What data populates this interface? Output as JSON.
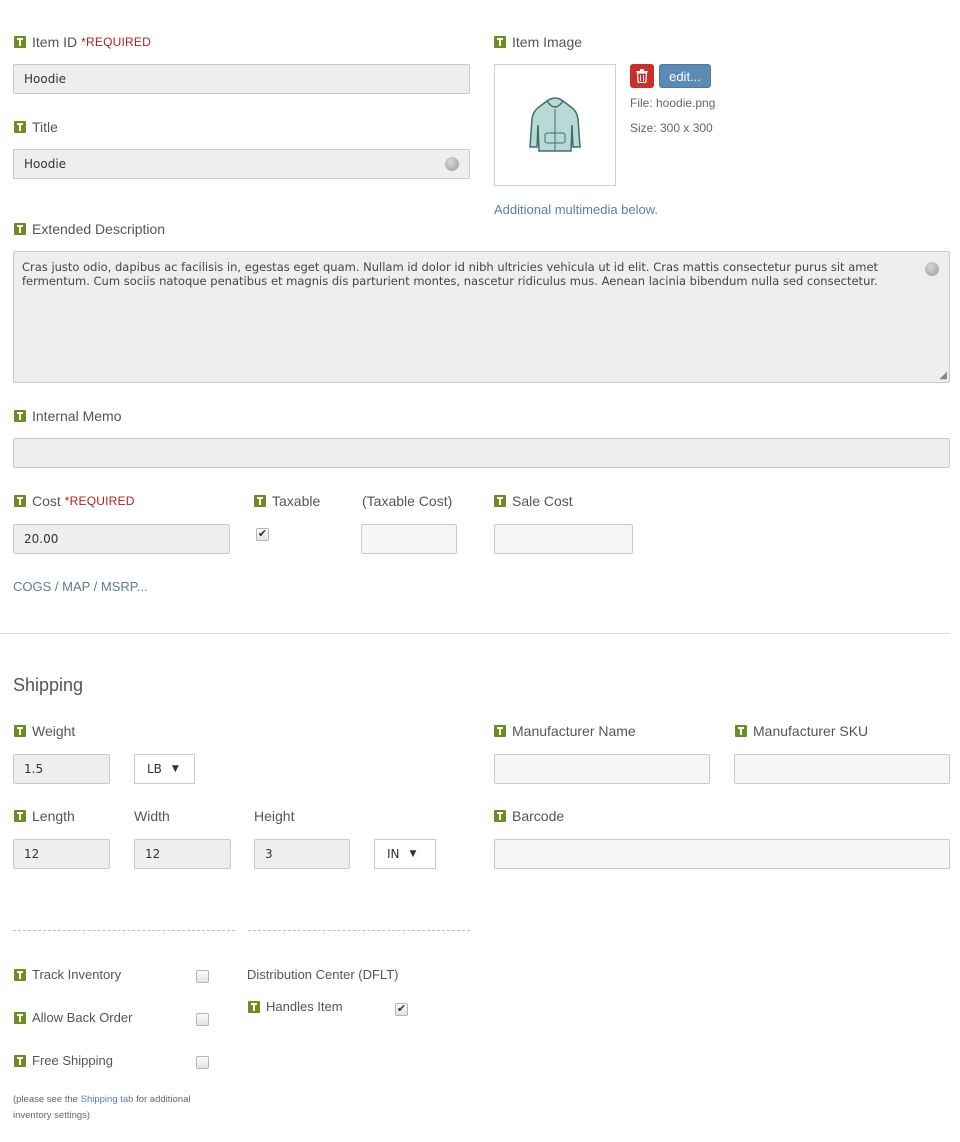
{
  "item_id": {
    "label": "Item ID",
    "required": "*REQUIRED",
    "value": "Hoodie"
  },
  "title": {
    "label": "Title",
    "value": "Hoodie"
  },
  "item_image": {
    "label": "Item Image",
    "edit_label": "edit...",
    "file": "File: hoodie.png",
    "size": "Size: 300 x 300",
    "additional": "Additional multimedia below."
  },
  "extended_description": {
    "label": "Extended Description",
    "value": "Cras justo odio, dapibus ac facilisis in, egestas eget quam. Nullam id dolor id nibh ultricies vehicula ut id elit. Cras mattis consectetur purus sit amet fermentum. Cum sociis natoque penatibus et magnis dis parturient montes, nascetur ridiculus mus. Aenean lacinia bibendum nulla sed consectetur."
  },
  "internal_memo": {
    "label": "Internal Memo",
    "value": ""
  },
  "cost": {
    "label": "Cost",
    "required": "*REQUIRED",
    "value": "20.00"
  },
  "taxable": {
    "label": "Taxable",
    "checked": true,
    "check_glyph": "✔"
  },
  "taxable_cost": {
    "label": "(Taxable Cost)",
    "value": ""
  },
  "sale_cost": {
    "label": "Sale Cost",
    "value": ""
  },
  "cogs_link": "COGS / MAP / MSRP...",
  "shipping": {
    "heading": "Shipping",
    "weight": {
      "label": "Weight",
      "value": "1.5",
      "unit": "LB"
    },
    "length": {
      "label": "Length",
      "value": "12"
    },
    "width": {
      "label": "Width",
      "value": "12"
    },
    "height": {
      "label": "Height",
      "value": "3"
    },
    "dim_unit": "IN",
    "manufacturer_name": {
      "label": "Manufacturer Name",
      "value": ""
    },
    "manufacturer_sku": {
      "label": "Manufacturer SKU",
      "value": ""
    },
    "barcode": {
      "label": "Barcode",
      "value": ""
    }
  },
  "inventory": {
    "track_inventory": {
      "label": "Track Inventory",
      "checked": false
    },
    "allow_back_order": {
      "label": "Allow Back Order",
      "checked": false
    },
    "free_shipping": {
      "label": "Free Shipping",
      "checked": false
    },
    "note_prefix": "(please see the ",
    "note_link": "Shipping tab",
    "note_suffix": " for additional inventory settings)",
    "distribution_center": "Distribution Center (DFLT)",
    "handles_item": {
      "label": "Handles Item",
      "checked": true,
      "check_glyph": "✔"
    }
  },
  "colors": {
    "hint_icon": "#6b8e23",
    "required": "#b22222",
    "link": "#5a7fa8",
    "delete_button": "#c9302c",
    "edit_button": "#5b8bb5"
  }
}
